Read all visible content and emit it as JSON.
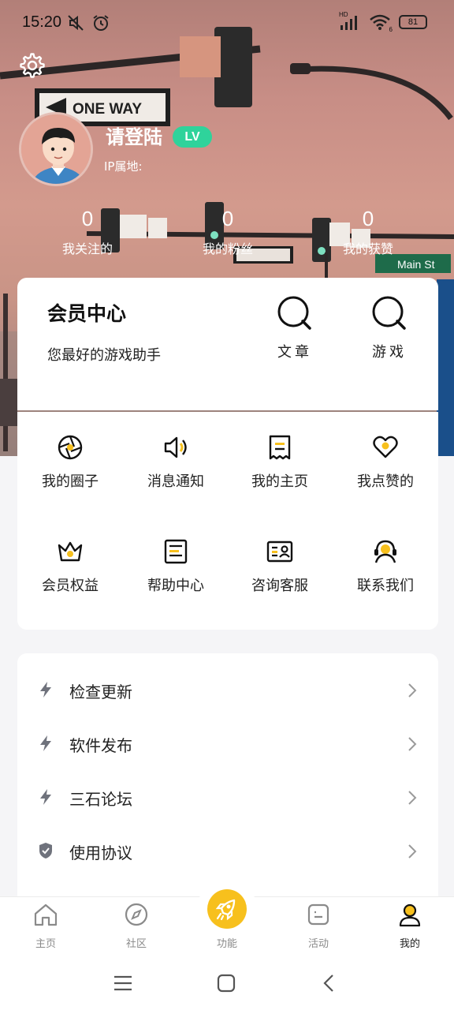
{
  "status_bar": {
    "time": "15:20",
    "battery": "81",
    "network_label": "HD",
    "wifi_label": "6"
  },
  "profile": {
    "username": "请登陆",
    "level_badge": "LV",
    "ip_label": "IP属地:",
    "stats": [
      {
        "count": "0",
        "label": "我关注的"
      },
      {
        "count": "0",
        "label": "我的粉丝"
      },
      {
        "count": "0",
        "label": "我的获赞"
      }
    ]
  },
  "member": {
    "title": "会员中心",
    "subtitle": "您最好的游戏助手",
    "links": [
      {
        "label": "文章",
        "icon": "search-icon"
      },
      {
        "label": "游戏",
        "icon": "search-icon"
      }
    ]
  },
  "features": [
    {
      "label": "我的圈子",
      "icon": "aperture-icon"
    },
    {
      "label": "消息通知",
      "icon": "speaker-icon"
    },
    {
      "label": "我的主页",
      "icon": "receipt-icon"
    },
    {
      "label": "我点赞的",
      "icon": "heart-icon"
    },
    {
      "label": "会员权益",
      "icon": "crown-icon"
    },
    {
      "label": "帮助中心",
      "icon": "document-icon"
    },
    {
      "label": "咨询客服",
      "icon": "contact-card-icon"
    },
    {
      "label": "联系我们",
      "icon": "headset-icon"
    }
  ],
  "settings_list": [
    {
      "label": "检查更新",
      "icon": "lightning-icon"
    },
    {
      "label": "软件发布",
      "icon": "lightning-icon"
    },
    {
      "label": "三石论坛",
      "icon": "lightning-icon"
    },
    {
      "label": "使用协议",
      "icon": "shield-icon"
    }
  ],
  "bottom_nav": [
    {
      "label": "主页",
      "icon": "home-icon"
    },
    {
      "label": "社区",
      "icon": "compass-icon"
    },
    {
      "label": "功能",
      "icon": "rocket-icon"
    },
    {
      "label": "活动",
      "icon": "activity-icon"
    },
    {
      "label": "我的",
      "icon": "user-icon",
      "active": true
    }
  ],
  "colors": {
    "accent": "#f7c01d",
    "badge": "#2fd39b",
    "card": "#ffffff",
    "background": "#f5f5f7"
  },
  "hero_sign": {
    "text": "ONE WAY",
    "street": "Main St"
  }
}
